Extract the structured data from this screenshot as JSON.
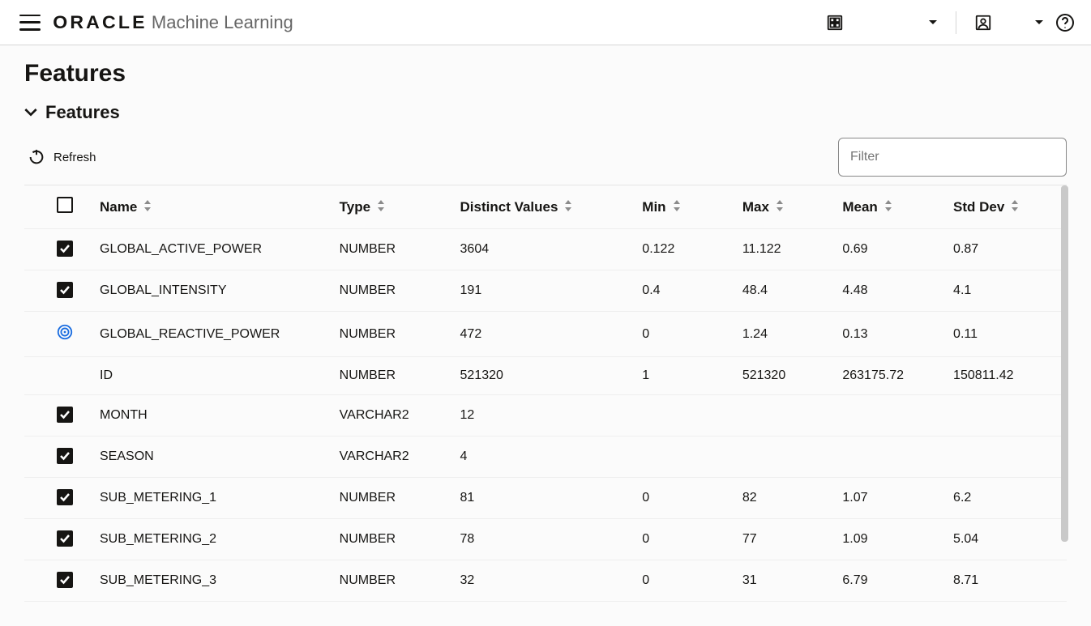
{
  "header": {
    "brand_main": "ORACLE",
    "brand_sub": "Machine Learning",
    "project_label": "",
    "user_label": ""
  },
  "page": {
    "title": "Features",
    "section_title": "Features",
    "refresh_label": "Refresh",
    "filter_placeholder": "Filter"
  },
  "table": {
    "columns": {
      "name": "Name",
      "type": "Type",
      "distinct": "Distinct Values",
      "min": "Min",
      "max": "Max",
      "mean": "Mean",
      "std": "Std Dev"
    },
    "rows": [
      {
        "status": "checked",
        "name": "GLOBAL_ACTIVE_POWER",
        "type": "NUMBER",
        "distinct": "3604",
        "min": "0.122",
        "max": "11.122",
        "mean": "0.69",
        "std": "0.87"
      },
      {
        "status": "checked",
        "name": "GLOBAL_INTENSITY",
        "type": "NUMBER",
        "distinct": "191",
        "min": "0.4",
        "max": "48.4",
        "mean": "4.48",
        "std": "4.1"
      },
      {
        "status": "target",
        "name": "GLOBAL_REACTIVE_POWER",
        "type": "NUMBER",
        "distinct": "472",
        "min": "0",
        "max": "1.24",
        "mean": "0.13",
        "std": "0.11"
      },
      {
        "status": "none",
        "name": "ID",
        "type": "NUMBER",
        "distinct": "521320",
        "min": "1",
        "max": "521320",
        "mean": "263175.72",
        "std": "150811.42"
      },
      {
        "status": "checked",
        "name": "MONTH",
        "type": "VARCHAR2",
        "distinct": "12",
        "min": "",
        "max": "",
        "mean": "",
        "std": ""
      },
      {
        "status": "checked",
        "name": "SEASON",
        "type": "VARCHAR2",
        "distinct": "4",
        "min": "",
        "max": "",
        "mean": "",
        "std": ""
      },
      {
        "status": "checked",
        "name": "SUB_METERING_1",
        "type": "NUMBER",
        "distinct": "81",
        "min": "0",
        "max": "82",
        "mean": "1.07",
        "std": "6.2"
      },
      {
        "status": "checked",
        "name": "SUB_METERING_2",
        "type": "NUMBER",
        "distinct": "78",
        "min": "0",
        "max": "77",
        "mean": "1.09",
        "std": "5.04"
      },
      {
        "status": "checked",
        "name": "SUB_METERING_3",
        "type": "NUMBER",
        "distinct": "32",
        "min": "0",
        "max": "31",
        "mean": "6.79",
        "std": "8.71"
      }
    ]
  }
}
